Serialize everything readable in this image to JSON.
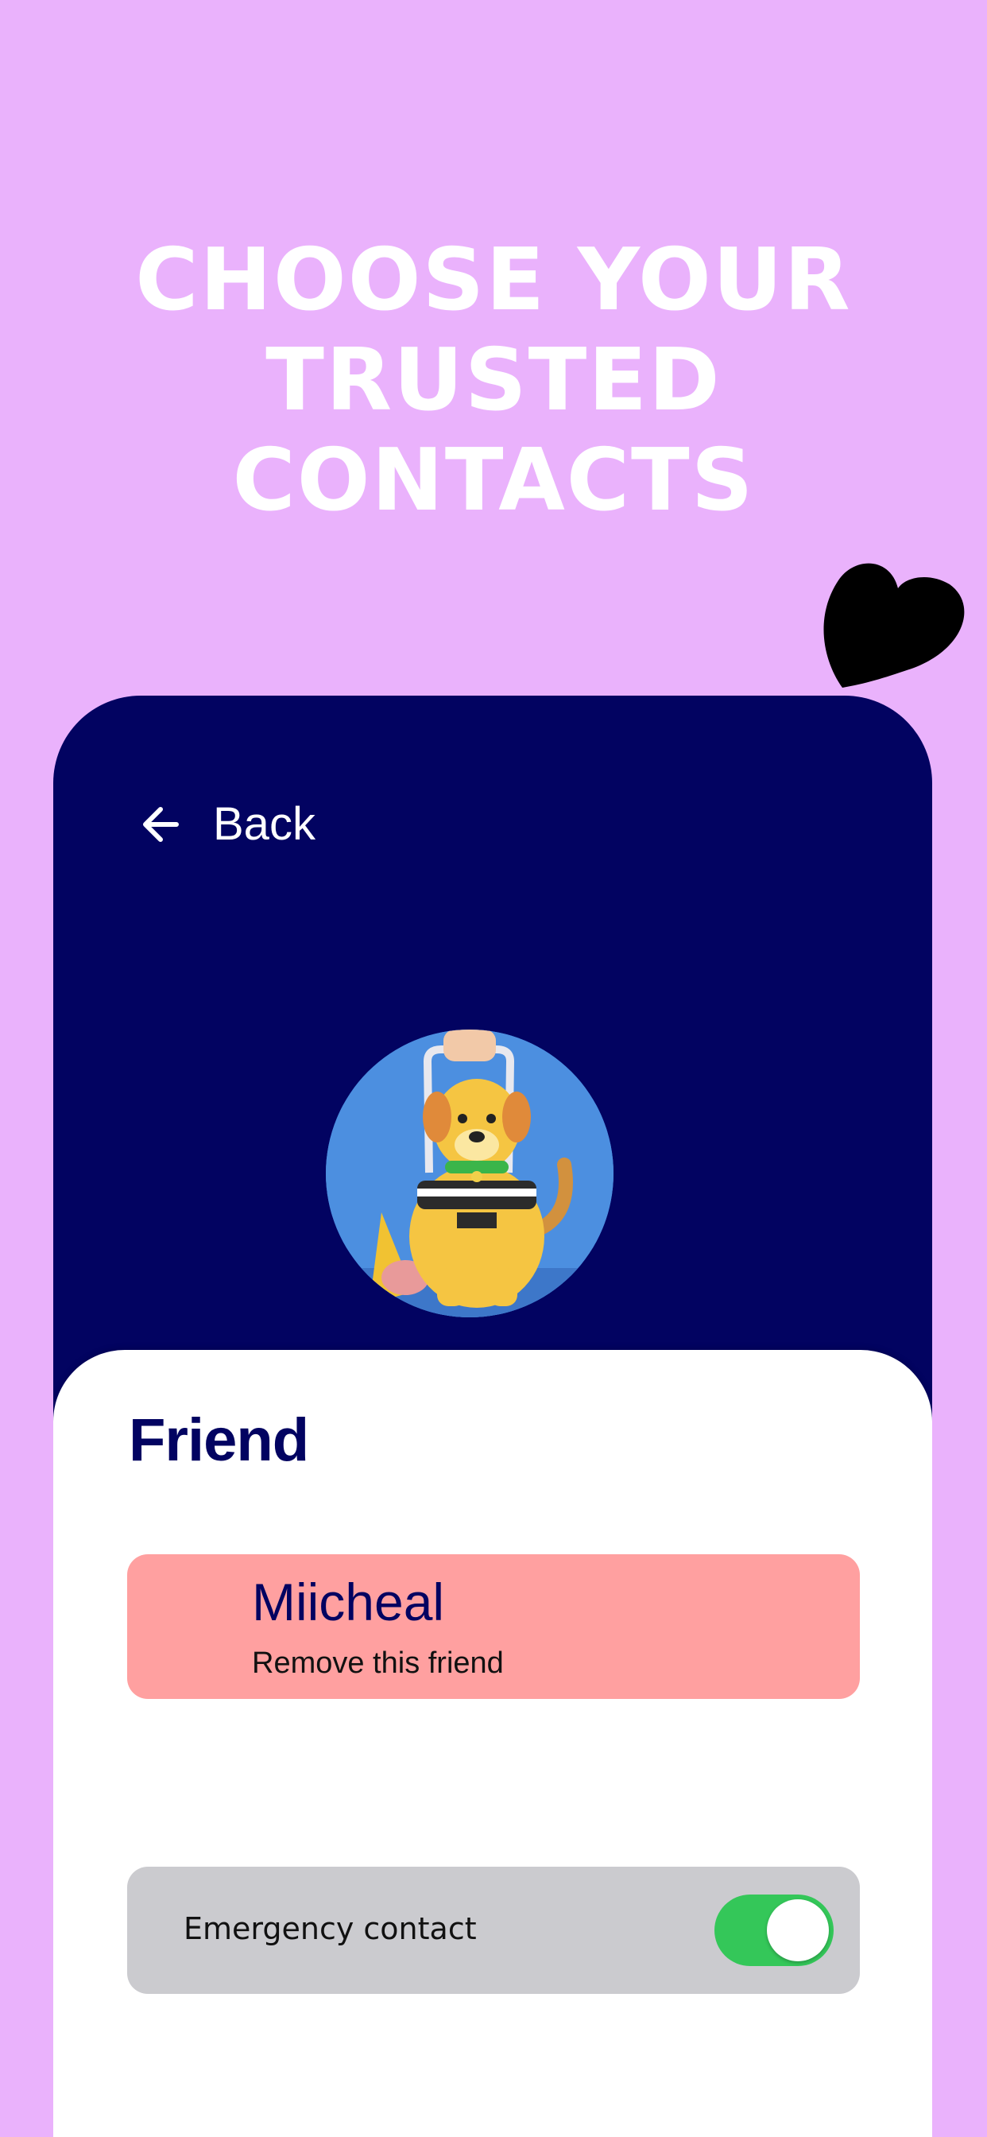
{
  "headline": {
    "lines": [
      "CHOOSE YOUR",
      "TRUSTED",
      "CONTACTS"
    ]
  },
  "decor": {
    "heart_icon": "heart-icon",
    "heart_color": "#000000"
  },
  "nav": {
    "back_label": "Back",
    "back_icon": "arrow-left-icon"
  },
  "profile": {
    "avatar_icon": "dog-avatar-icon"
  },
  "sheet": {
    "title": "Friend",
    "friend": {
      "name": "Miicheal",
      "action": "Remove this friend",
      "card_color": "#FFA0A0"
    },
    "emergency": {
      "label": "Emergency contact",
      "enabled": true,
      "toggle_color": "#34C759"
    }
  },
  "colors": {
    "background": "#EAB2FC",
    "panel": "#020361",
    "headline": "#FFFFFF"
  }
}
